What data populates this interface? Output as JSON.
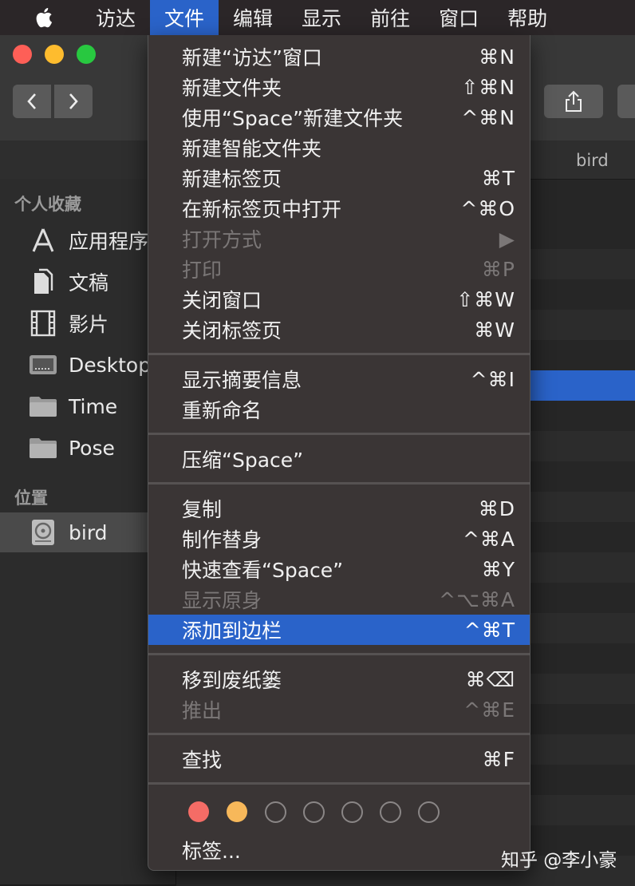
{
  "menubar": {
    "apple_icon": "apple-logo",
    "items": [
      "访达",
      "文件",
      "编辑",
      "显示",
      "前往",
      "窗口",
      "帮助"
    ],
    "active_index": 1
  },
  "window": {
    "path_title": "bird",
    "traffic_colors": [
      "#fe5f57",
      "#febc2e",
      "#28c840"
    ]
  },
  "sidebar": {
    "favorites_heading": "个人收藏",
    "favorites": [
      {
        "label": "应用程序",
        "icon": "applications-icon"
      },
      {
        "label": "文稿",
        "icon": "documents-icon"
      },
      {
        "label": "影片",
        "icon": "movies-icon"
      },
      {
        "label": "Desktop",
        "icon": "desktop-folder-icon"
      },
      {
        "label": "Time",
        "icon": "folder-icon"
      },
      {
        "label": "Pose",
        "icon": "folder-icon"
      }
    ],
    "locations_heading": "位置",
    "locations": [
      {
        "label": "bird",
        "icon": "disk-icon"
      }
    ]
  },
  "file_menu": {
    "items": [
      {
        "label": "新建“访达”窗口",
        "shortcut": "⌘N",
        "disabled": false
      },
      {
        "label": "新建文件夹",
        "shortcut": "⇧⌘N",
        "disabled": false
      },
      {
        "label": "使用“Space”新建文件夹",
        "shortcut": "^⌘N",
        "disabled": false
      },
      {
        "label": "新建智能文件夹",
        "shortcut": "",
        "disabled": false
      },
      {
        "label": "新建标签页",
        "shortcut": "⌘T",
        "disabled": false
      },
      {
        "label": "在新标签页中打开",
        "shortcut": "^⌘O",
        "disabled": false
      },
      {
        "label": "打开方式",
        "shortcut": "▶",
        "disabled": true
      },
      {
        "label": "打印",
        "shortcut": "⌘P",
        "disabled": true
      },
      {
        "label": "关闭窗口",
        "shortcut": "⇧⌘W",
        "disabled": false
      },
      {
        "label": "关闭标签页",
        "shortcut": "⌘W",
        "disabled": false
      },
      {
        "label": "显示摘要信息",
        "shortcut": "^⌘I",
        "disabled": false
      },
      {
        "label": "重新命名",
        "shortcut": "",
        "disabled": false
      },
      {
        "label": "压缩“Space”",
        "shortcut": "",
        "disabled": false
      },
      {
        "label": "复制",
        "shortcut": "⌘D",
        "disabled": false
      },
      {
        "label": "制作替身",
        "shortcut": "^⌘A",
        "disabled": false
      },
      {
        "label": "快速查看“Space”",
        "shortcut": "⌘Y",
        "disabled": false
      },
      {
        "label": "显示原身",
        "shortcut": "^⌥⌘A",
        "disabled": true
      },
      {
        "label": "添加到边栏",
        "shortcut": "^⌘T",
        "disabled": false,
        "highlighted": true
      },
      {
        "label": "移到废纸篓",
        "shortcut": "⌘⌫",
        "disabled": false
      },
      {
        "label": "推出",
        "shortcut": "^⌘E",
        "disabled": true
      },
      {
        "label": "查找",
        "shortcut": "⌘F",
        "disabled": false
      }
    ],
    "tag_colors": [
      "#f46c66",
      "#f7b85a",
      "empty",
      "empty",
      "empty",
      "empty",
      "empty"
    ],
    "tags_label": "标签..."
  },
  "watermark": "知乎 @李小豪",
  "colors": {
    "accent": "#2a63c9",
    "menu_bg": "#3a3535"
  }
}
